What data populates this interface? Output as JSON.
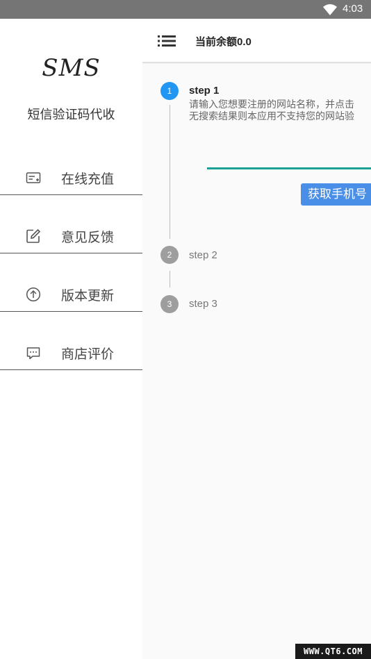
{
  "status_bar": {
    "time": "4:03"
  },
  "toolbar": {
    "title": "当前余额0.0"
  },
  "steps": [
    {
      "number": "1",
      "title": "step 1",
      "description_line1": "请输入您想要注册的网站名称，并点击",
      "description_line2": "无搜索结果则本应用不支持您的网站验",
      "button_label": "获取手机号"
    },
    {
      "number": "2",
      "title": "step 2"
    },
    {
      "number": "3",
      "title": "step 3"
    }
  ],
  "drawer": {
    "logo": "SMS",
    "app_name": "短信验证码代收",
    "items": [
      {
        "label": "在线充值",
        "icon": "card-icon"
      },
      {
        "label": "意见反馈",
        "icon": "edit-icon"
      },
      {
        "label": "版本更新",
        "icon": "upgrade-icon"
      },
      {
        "label": "商店评价",
        "icon": "comment-icon"
      }
    ]
  },
  "watermark": "WWW.QT6.COM",
  "colors": {
    "accent": "#2196f3",
    "button": "#4a8fe7",
    "input_line": "#1a9f94",
    "status_bar": "#757575"
  }
}
